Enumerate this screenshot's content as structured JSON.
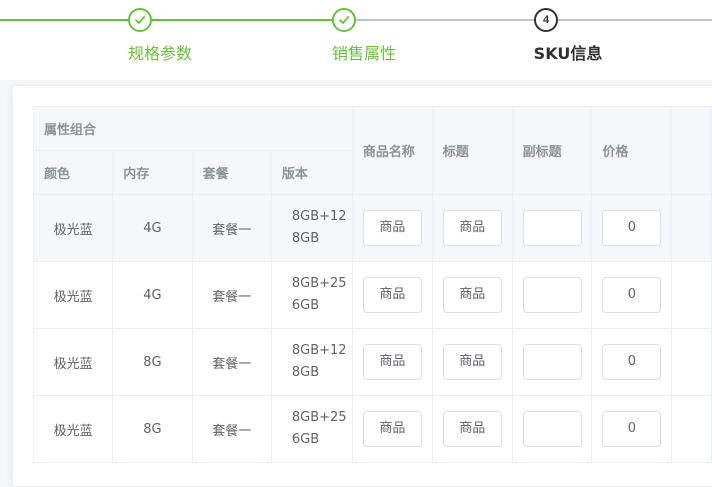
{
  "steps": [
    {
      "title": "规格参数",
      "status": "done"
    },
    {
      "title": "销售属性",
      "status": "done"
    },
    {
      "title": "SKU信息",
      "status": "current",
      "number": "4"
    }
  ],
  "table": {
    "group_header": "属性组合",
    "attr_headers": [
      "颜色",
      "内存",
      "套餐",
      "版本"
    ],
    "field_headers": [
      "商品名称",
      "标题",
      "副标题",
      "价格"
    ],
    "rows": [
      {
        "color": "极光蓝",
        "memory": "4G",
        "package": "套餐一",
        "version": "8GB+128GB",
        "name": "商品",
        "title": "商品",
        "subtitle": "",
        "price": "0"
      },
      {
        "color": "极光蓝",
        "memory": "4G",
        "package": "套餐一",
        "version": "8GB+256GB",
        "name": "商品",
        "title": "商品",
        "subtitle": "",
        "price": "0"
      },
      {
        "color": "极光蓝",
        "memory": "8G",
        "package": "套餐一",
        "version": "8GB+128GB",
        "name": "商品",
        "title": "商品",
        "subtitle": "",
        "price": "0"
      },
      {
        "color": "极光蓝",
        "memory": "8G",
        "package": "套餐一",
        "version": "8GB+256GB",
        "name": "商品",
        "title": "商品",
        "subtitle": "",
        "price": "0"
      }
    ]
  },
  "colors": {
    "done": "#67c23a",
    "current": "#303133",
    "pending_line": "#c0c4cc",
    "highlight_row": "#f5f7fa"
  },
  "icons": {
    "done_step": "check-icon"
  }
}
